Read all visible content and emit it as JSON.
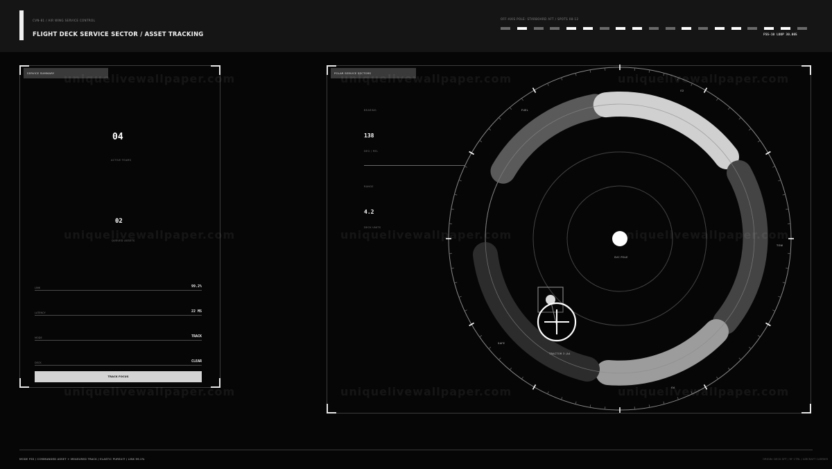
{
  "header": {
    "subtitle": "CVN-81 / AIR WING SERVICE CONTROL",
    "title": "FLIGHT DECK SERVICE SECTOR / ASSET TRACKING",
    "right_label": "OFF-AXIS POLE: STARBOARD AFT / SPOTS 08-12",
    "status": "FSS-10  LOOP 30.005",
    "segments": [
      "#6a6a6a",
      "#ffffff",
      "#6a6a6a",
      "#6a6a6a",
      "#ffffff",
      "#ffffff",
      "#6a6a6a",
      "#ffffff",
      "#ffffff",
      "#6a6a6a",
      "#6a6a6a",
      "#ffffff",
      "#6a6a6a",
      "#ffffff",
      "#ffffff",
      "#6a6a6a",
      "#ffffff",
      "#ffffff",
      "#6a6a6a"
    ]
  },
  "summary_panel": {
    "tab_label": "SERVICE SUMMARY",
    "active_teams_value": "04",
    "active_teams_label": "ACTIVE TEAMS",
    "queue_value": "02",
    "queue_label": "QUEUED ASSETS",
    "rows": [
      {
        "label": "LINK",
        "value": "99.2%"
      },
      {
        "label": "LATENCY",
        "value": "22 MS"
      },
      {
        "label": "MODE",
        "value": "TRACK"
      },
      {
        "label": "DECK",
        "value": "CLEAR"
      }
    ],
    "button_label": "TRACK FOCUS"
  },
  "sector_panel": {
    "tab_label": "POLAR SERVICE SECTORS",
    "stat1_label": "BEARING",
    "stat1_value": "138",
    "stat1_sub": "DEG / REL",
    "stat2_label": "RANGE",
    "stat2_value": "4.2",
    "stat2_sub": "DECK UNITS",
    "pole_label": "SVC POLE",
    "sector_labels": [
      "FUEL",
      "O2",
      "TOW",
      "OA",
      "SAFE"
    ],
    "asset_label": "TRACTOR 3 /A4"
  },
  "watermark": "uniquelivewallpaper.com",
  "footer": {
    "left": "MODE FSS / COMMANDED ASSET + MEASURED TRACK / ELASTIC PURSUIT / LINK 99.2%",
    "right": "ORIGIN: DECK SPT / RF CTRL / AIRCRAFT CARRIER"
  }
}
